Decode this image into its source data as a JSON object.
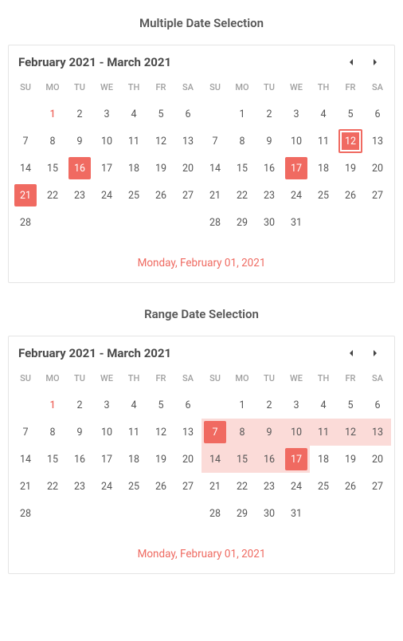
{
  "sections": {
    "multiple": {
      "title": "Multiple Date Selection",
      "header": "February 2021 - March 2021",
      "footer": "Monday, February 01, 2021"
    },
    "range": {
      "title": "Range Date Selection",
      "header": "February 2021 - March 2021",
      "footer": "Monday, February 01, 2021"
    }
  },
  "dow": [
    "SU",
    "MO",
    "TU",
    "WE",
    "TH",
    "FR",
    "SA"
  ],
  "months": {
    "feb": {
      "name": "February",
      "year": 2021,
      "startDow": 1,
      "days": 28
    },
    "mar": {
      "name": "March",
      "year": 2021,
      "startDow": 1,
      "days": 31
    }
  },
  "multiple_state": {
    "today": {
      "month": "feb",
      "day": 1
    },
    "selected": [
      {
        "month": "feb",
        "day": 16
      },
      {
        "month": "feb",
        "day": 21
      },
      {
        "month": "mar",
        "day": 17
      }
    ],
    "selected_outlined": [
      {
        "month": "mar",
        "day": 12
      }
    ]
  },
  "range_state": {
    "today": {
      "month": "feb",
      "day": 1
    },
    "range": {
      "startMonth": "mar",
      "startDay": 7,
      "endMonth": "mar",
      "endDay": 17
    }
  },
  "colors": {
    "accent": "#f06a61",
    "rangeBg": "#fbdbd8"
  }
}
